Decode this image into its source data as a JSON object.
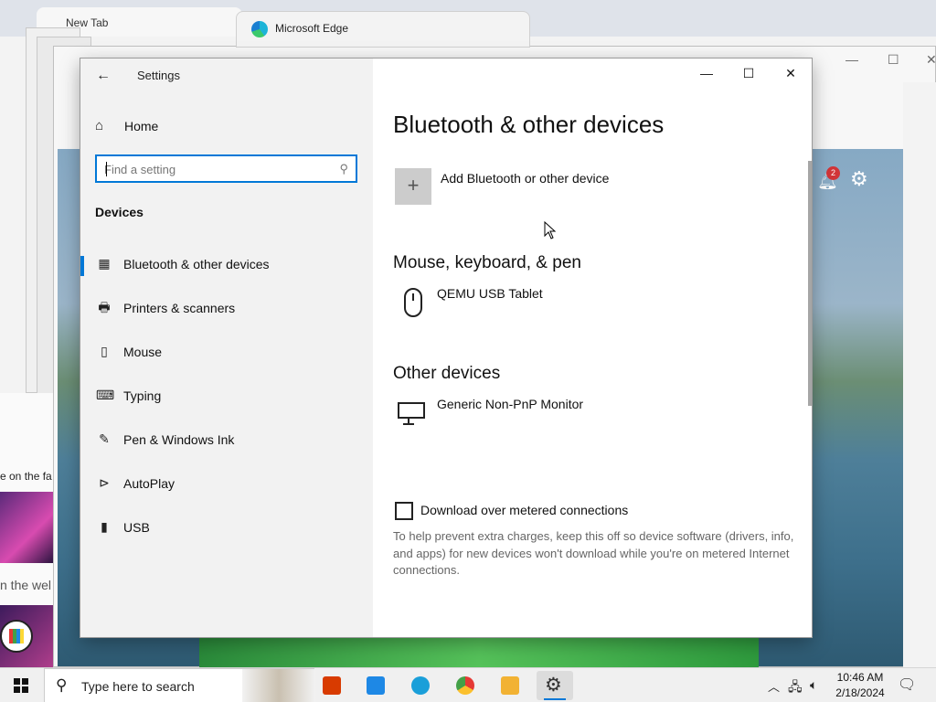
{
  "background": {
    "edge_back_tab": "New Tab",
    "edge_window_title": "Microsoft Edge",
    "notification_count": "2",
    "side_text_1": "e on the fa",
    "side_text_2": "n the wel"
  },
  "settings": {
    "app_title": "Settings",
    "home_label": "Home",
    "search_placeholder": "Find a setting",
    "section_label": "Devices",
    "nav_items": [
      {
        "label": "Bluetooth & other devices",
        "icon": "bluetooth-devices-icon",
        "selected": true
      },
      {
        "label": "Printers & scanners",
        "icon": "printer-icon"
      },
      {
        "label": "Mouse",
        "icon": "mouse-icon"
      },
      {
        "label": "Typing",
        "icon": "keyboard-icon"
      },
      {
        "label": "Pen & Windows Ink",
        "icon": "pen-icon"
      },
      {
        "label": "AutoPlay",
        "icon": "autoplay-icon"
      },
      {
        "label": "USB",
        "icon": "usb-icon"
      }
    ],
    "window_controls": {
      "minimize": "—",
      "maximize": "☐",
      "close": "✕"
    },
    "content": {
      "title": "Bluetooth & other devices",
      "add_device_label": "Add Bluetooth or other device",
      "mouse_section": "Mouse, keyboard, & pen",
      "mouse_device": "QEMU USB Tablet",
      "other_section": "Other devices",
      "other_device": "Generic Non-PnP Monitor",
      "metered_checkbox_label": "Download over metered connections",
      "metered_checkbox_checked": false,
      "metered_help": "To help prevent extra charges, keep this off so device software (drivers, info, and apps) for new devices won't download while you're on metered Internet connections."
    }
  },
  "taskbar": {
    "search_text": "Type here to search",
    "apps": [
      {
        "name": "office",
        "color": "#d83b01"
      },
      {
        "name": "store",
        "color": "#1e88e5"
      },
      {
        "name": "edge",
        "color": "#1a9fd9"
      },
      {
        "name": "chrome",
        "color": "#e53935"
      },
      {
        "name": "file-explorer",
        "color": "#f2b233"
      },
      {
        "name": "settings",
        "color": "#555555"
      }
    ],
    "time": "10:46 AM",
    "date": "2/18/2024"
  },
  "colors": {
    "accent": "#0078d7",
    "sidebar_bg": "#f2f2f2"
  }
}
